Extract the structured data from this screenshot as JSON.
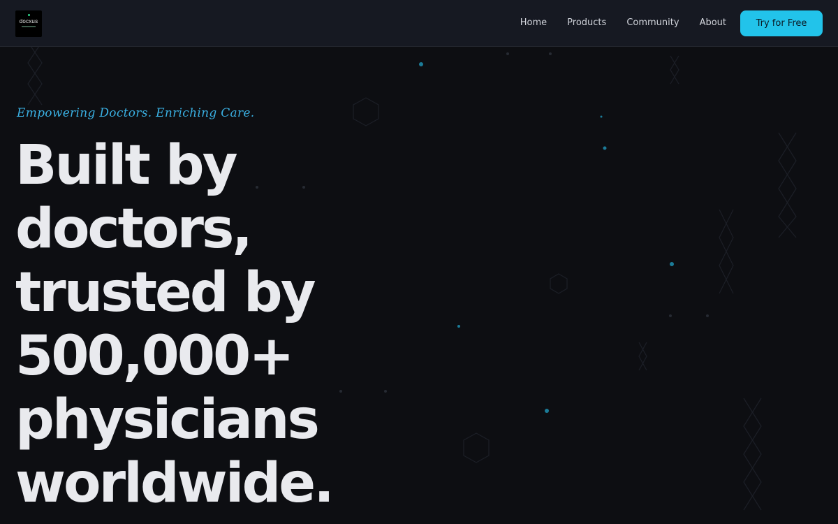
{
  "navbar": {
    "logo_text": "docxus",
    "links": [
      "Home",
      "Products",
      "Community",
      "About"
    ],
    "cta_label": "Try for Free"
  },
  "hero": {
    "tagline": "Empowering Doctors. Enriching Care.",
    "headline_lines": [
      "Built by",
      "doctors,",
      "trusted by",
      "500,000+",
      "physicians",
      "worldwide."
    ]
  },
  "colors": {
    "background": "#0d0e12",
    "navbar": "#161922",
    "accent": "#22c3ea",
    "tagline": "#3ab0e3",
    "headline": "#e9eaee"
  }
}
